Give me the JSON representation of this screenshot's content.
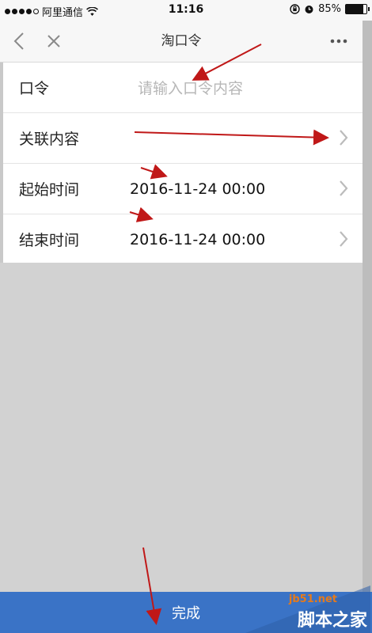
{
  "status_bar": {
    "carrier": "阿里通信",
    "time": "11:16",
    "battery": "85%",
    "battery_level": 0.85
  },
  "nav": {
    "title": "淘口令"
  },
  "form": {
    "rows": [
      {
        "label": "口令",
        "placeholder": "请输入口令内容",
        "value": ""
      },
      {
        "label": "关联内容",
        "value": ""
      },
      {
        "label": "起始时间",
        "value": "2016-11-24 00:00"
      },
      {
        "label": "结束时间",
        "value": "2016-11-24 00:00"
      }
    ]
  },
  "footer": {
    "done_label": "完成"
  },
  "watermark": {
    "url": "jb51.net",
    "name": "脚本之家"
  },
  "colors": {
    "primary_button": "#3a73c6",
    "annotation_arrow": "#c01818"
  }
}
